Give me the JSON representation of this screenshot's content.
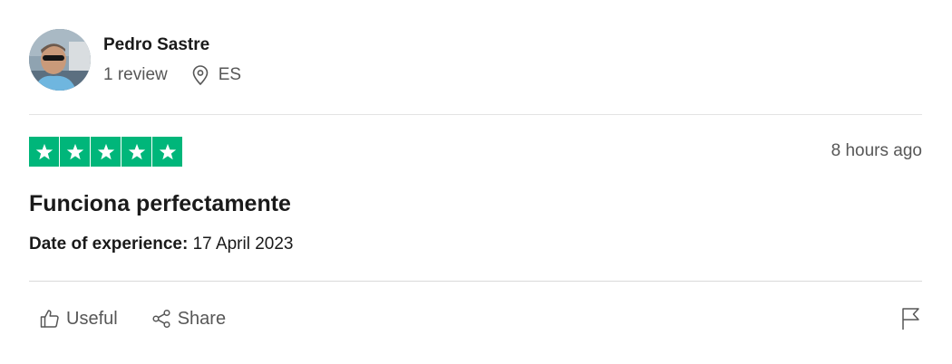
{
  "consumer": {
    "name": "Pedro Sastre",
    "review_count": "1 review",
    "country": "ES"
  },
  "review": {
    "rating": 5,
    "max_rating": 5,
    "star_color": "#00b67a",
    "timestamp": "8 hours ago",
    "title": "Funciona perfectamente",
    "experience_label": "Date of experience:",
    "experience_date": "17 April 2023"
  },
  "actions": {
    "useful_label": "Useful",
    "share_label": "Share"
  },
  "icons": [
    "location-pin-icon",
    "star-icon",
    "thumbs-up-icon",
    "share-icon",
    "flag-icon"
  ]
}
